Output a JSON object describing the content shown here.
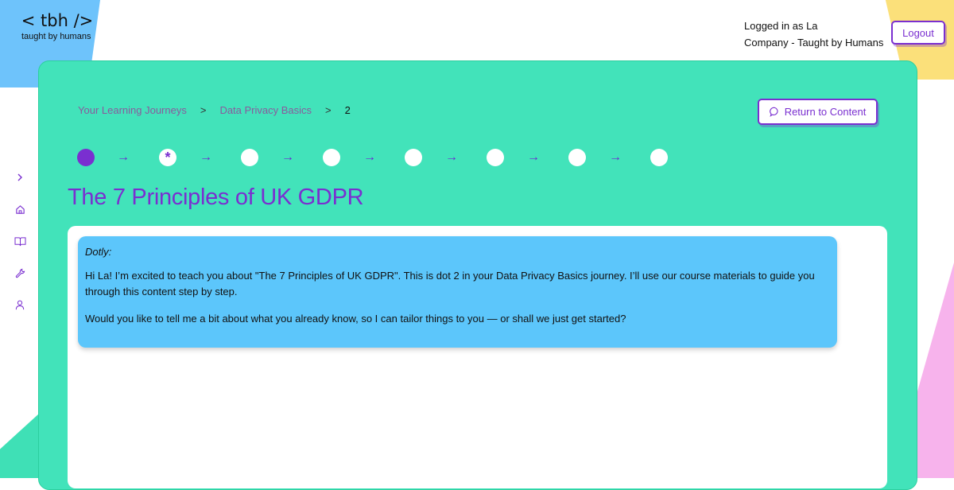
{
  "brand": {
    "logo_mark": "< tbh />",
    "tagline": "taught by humans"
  },
  "header": {
    "logged_in_text": "Logged in as La",
    "company_text": "Company - Taught by Humans",
    "logout_label": "Logout"
  },
  "sidebar": {
    "items": [
      {
        "icon": "chevron-right-icon"
      },
      {
        "icon": "home-icon"
      },
      {
        "icon": "book-icon"
      },
      {
        "icon": "wrench-icon"
      },
      {
        "icon": "user-icon"
      }
    ]
  },
  "breadcrumb": {
    "items": [
      "Your Learning Journeys",
      "Data Privacy Basics"
    ],
    "current": "2",
    "separator": ">"
  },
  "return_button": {
    "label": "Return to Content",
    "icon": "chat-bubble-icon"
  },
  "progress": {
    "total_dots": 8,
    "current_dot": 2,
    "completed_dots": 1,
    "current_symbol": "*",
    "arrow": "→"
  },
  "page_title": "The 7 Principles of UK GDPR",
  "chat": {
    "speaker": "Dotly:",
    "paragraphs": [
      "Hi La! I’m excited to teach you about \"The 7 Principles of UK GDPR\". This is dot 2 in your Data Privacy Basics journey. I’ll use our course materials to guide you through this content step by step.",
      "Would you like to tell me a bit about what you already know, so I can tailor things to you — or shall we just get started?"
    ]
  },
  "colors": {
    "panel_green": "#42e3ba",
    "accent_purple": "#7a2fd0",
    "bubble_blue": "#5cc6fb"
  }
}
